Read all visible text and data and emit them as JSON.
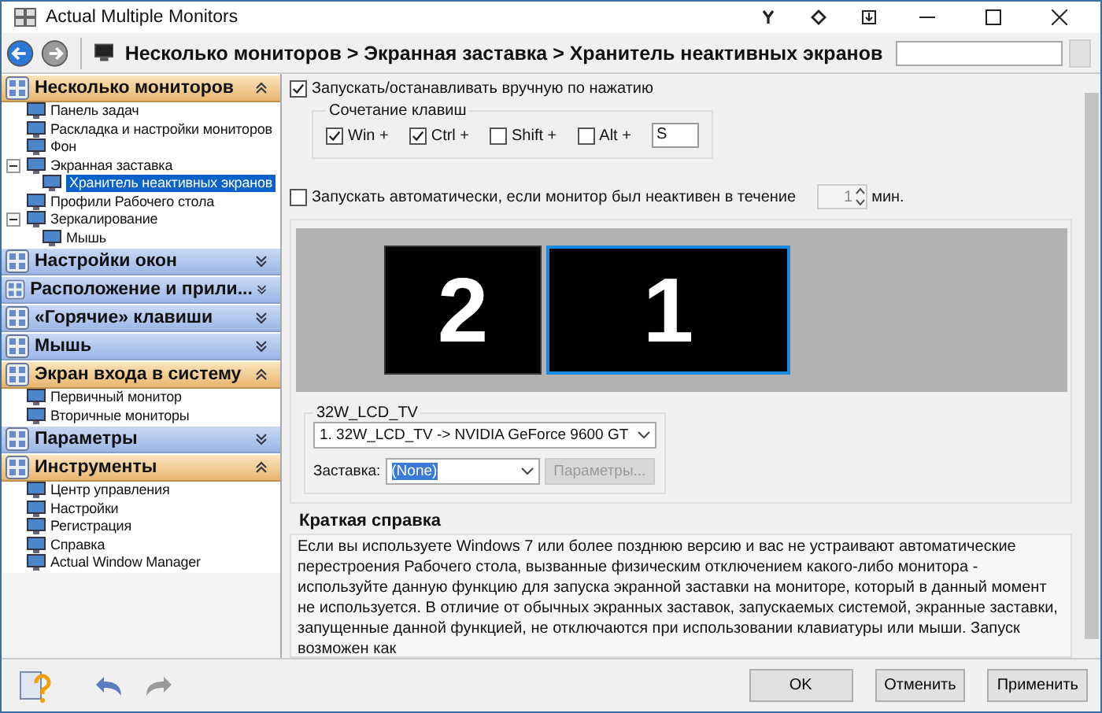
{
  "window": {
    "title": "Actual Multiple Monitors"
  },
  "nav": {
    "back_enabled": true,
    "forward_enabled": false,
    "breadcrumb": "Несколько мониторов > Экранная заставка > Хранитель неактивных экранов"
  },
  "sidebar": {
    "sections": [
      {
        "title": "Несколько мониторов",
        "expanded": true,
        "items": [
          {
            "label": "Панель задач",
            "selected": false
          },
          {
            "label": "Раскладка и настройки мониторов",
            "selected": false
          },
          {
            "label": "Фон",
            "selected": false
          },
          {
            "label": "Экранная заставка",
            "selected": false,
            "expanded": true,
            "children": [
              {
                "label": "Хранитель неактивных экранов",
                "selected": true
              }
            ]
          },
          {
            "label": "Профили Рабочего стола",
            "selected": false
          },
          {
            "label": "Зеркалирование",
            "selected": false,
            "expanded": true,
            "children": [
              {
                "label": "Мышь",
                "selected": false
              }
            ]
          }
        ]
      },
      {
        "title": "Настройки окон",
        "expanded": false
      },
      {
        "title": "Расположение и прили...",
        "expanded": false
      },
      {
        "title": "«Горячие» клавиши",
        "expanded": false
      },
      {
        "title": "Мышь",
        "expanded": false
      },
      {
        "title": "Экран входа в систему",
        "expanded": true,
        "items": [
          {
            "label": "Первичный монитор",
            "selected": false
          },
          {
            "label": "Вторичные мониторы",
            "selected": false
          }
        ]
      },
      {
        "title": "Параметры",
        "expanded": false
      },
      {
        "title": "Инструменты",
        "expanded": true,
        "items": [
          {
            "label": "Центр управления",
            "selected": false
          },
          {
            "label": "Настройки",
            "selected": false
          },
          {
            "label": "Регистрация",
            "selected": false
          },
          {
            "label": "Справка",
            "selected": false
          },
          {
            "label": "Actual Window Manager",
            "selected": false
          }
        ]
      }
    ]
  },
  "content": {
    "manual_start": {
      "label": "Запускать/останавливать вручную по нажатию",
      "checked": true
    },
    "hotkey": {
      "title": "Сочетание клавиш",
      "keys": [
        {
          "label": "Win +",
          "checked": true
        },
        {
          "label": "Ctrl +",
          "checked": true
        },
        {
          "label": "Shift +",
          "checked": false
        },
        {
          "label": "Alt +",
          "checked": false
        }
      ],
      "key": "S"
    },
    "auto_start": {
      "label": "Запускать автоматически, если монитор был неактивен в течение",
      "checked": false,
      "minutes": "1",
      "unit": "мин."
    },
    "monitors": [
      {
        "number": "2",
        "selected": false
      },
      {
        "number": "1",
        "selected": true
      }
    ],
    "monitor_group": {
      "title": "32W_LCD_TV",
      "device": "1. 32W_LCD_TV -> NVIDIA GeForce 9600 GT",
      "screensaver_label": "Заставка:",
      "screensaver": "(None)",
      "settings_button": {
        "label": "Параметры...",
        "disabled": true
      }
    },
    "help": {
      "title": "Краткая справка",
      "text": "Если вы используете Windows 7 или более позднюю версию и вас не устраивают автоматические перестроения Рабочего стола, вызванные физическим отключением какого-либо монитора - используйте данную функцию для запуска экранной заставки на мониторе, который в данный момент не используется. В отличие от обычных экранных заставок, запускаемых системой, экранные заставки, запущенные данной функцией, не отключаются при использовании клавиатуры или мыши. Запуск возможен как"
    }
  },
  "footer": {
    "undo_enabled": true,
    "redo_enabled": false,
    "buttons": [
      "OK",
      "Отменить",
      "Применить"
    ]
  }
}
